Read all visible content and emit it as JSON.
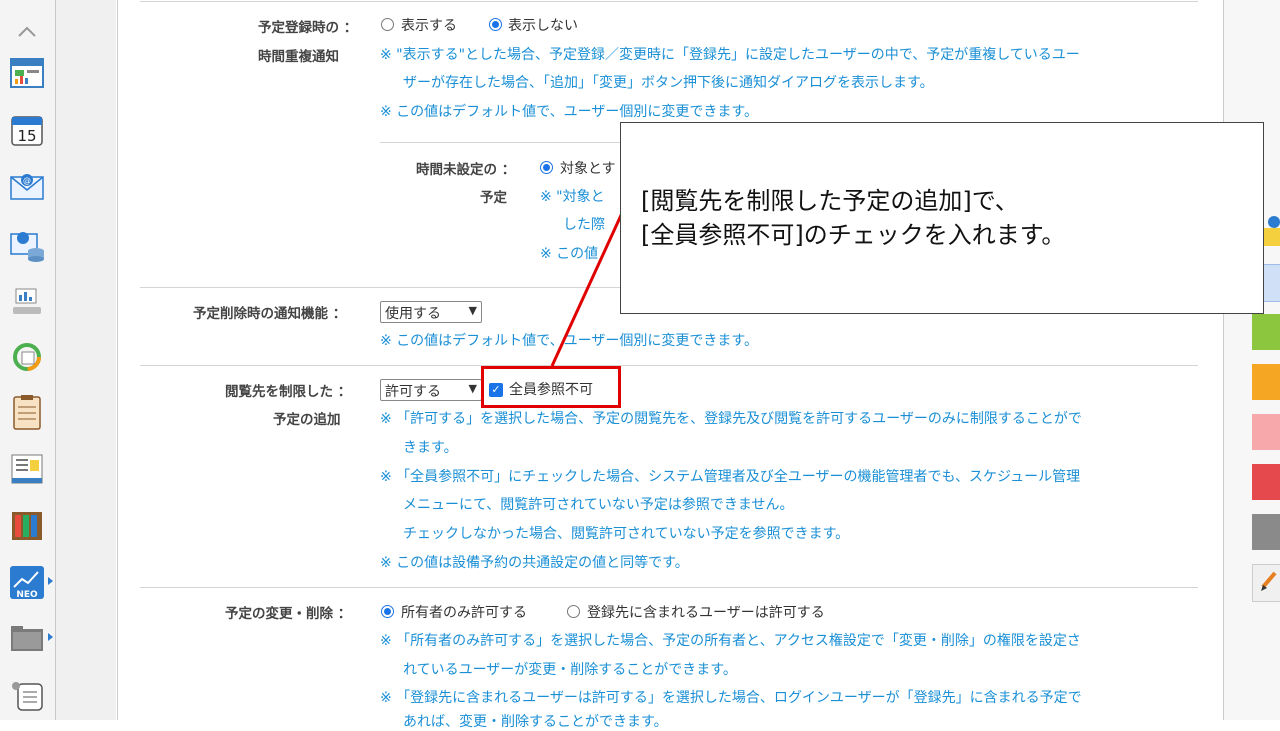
{
  "sidebar": {
    "items": [
      {
        "icon": "chevron-up-icon"
      },
      {
        "icon": "portal-icon"
      },
      {
        "icon": "calendar-icon",
        "label": "15"
      },
      {
        "icon": "mail-icon"
      },
      {
        "icon": "webmail-icon"
      },
      {
        "icon": "workflow-icon"
      },
      {
        "icon": "sync-icon"
      },
      {
        "icon": "clipboard-icon"
      },
      {
        "icon": "bulletin-icon"
      },
      {
        "icon": "cabinet-icon"
      },
      {
        "icon": "neo-icon",
        "label": "NEO"
      },
      {
        "icon": "folder-icon"
      },
      {
        "icon": "settings-list-icon"
      }
    ]
  },
  "section1": {
    "label_line1": "予定登録時の",
    "colon": "：",
    "label_line2": "時間重複通知",
    "radio_show": "表示する",
    "radio_hide": "表示しない",
    "note1_line1": "※ \"表示する\"とした場合、予定登録／変更時に「登録先」に設定したユーザーの中で、予定が重複しているユー",
    "note1_line2": "ザーが存在した場合、「追加」「変更」ボタン押下後に通知ダイアログを表示します。",
    "note2": "※ この値はデフォルト値で、ユーザー個別に変更できます。",
    "sub_label_line1": "時間未設定の",
    "sub_colon": "：",
    "sub_label_line2": "予定",
    "sub_radio": "対象とす",
    "sub_note1_line1": "※ \"対象と",
    "sub_note1_line2": "した際",
    "sub_note2": "※ この値"
  },
  "section2": {
    "label": "予定削除時の通知機能",
    "colon": "：",
    "select_value": "使用する",
    "note": "※ この値はデフォルト値で、ユーザー個別に変更できます。"
  },
  "section3": {
    "label_line1": "閲覧先を制限した",
    "colon": "：",
    "label_line2": "予定の追加",
    "select_value": "許可する",
    "checkbox_label": "全員参照不可",
    "note1_line1": "※ 「許可する」を選択した場合、予定の閲覧先を、登録先及び閲覧を許可するユーザーのみに制限することがで",
    "note1_line2": "きます。",
    "note2_line1": "※ 「全員参照不可」にチェックした場合、システム管理者及び全ユーザーの機能管理者でも、スケジュール管理",
    "note2_line2": "メニューにて、閲覧許可されていない予定は参照できません。",
    "note2_line3": "チェックしなかった場合、閲覧許可されていない予定を参照できます。",
    "note3": "※ この値は設備予約の共通設定の値と同等です。"
  },
  "section4": {
    "label": "予定の変更・削除",
    "colon": "：",
    "radio_owner": "所有者のみ許可する",
    "radio_members": "登録先に含まれるユーザーは許可する",
    "note1_line1": "※ 「所有者のみ許可する」を選択した場合、予定の所有者と、アクセス権設定で「変更・削除」の権限を設定さ",
    "note1_line2": "れているユーザーが変更・削除することができます。",
    "note2_line1": "※ 「登録先に含まれるユーザーは許可する」を選択した場合、ログインユーザーが「登録先」に含まれる予定で",
    "note2_line2": "あれば、変更・削除することができます。"
  },
  "callout": {
    "line1": "[閲覧先を制限した予定の追加]で、",
    "line2": "[全員参照不可]のチェックを入れます。"
  },
  "colors": {
    "note_blue": "#1a8fd6",
    "highlight_red": "#e00000",
    "radio_blue": "#1a73e8"
  }
}
